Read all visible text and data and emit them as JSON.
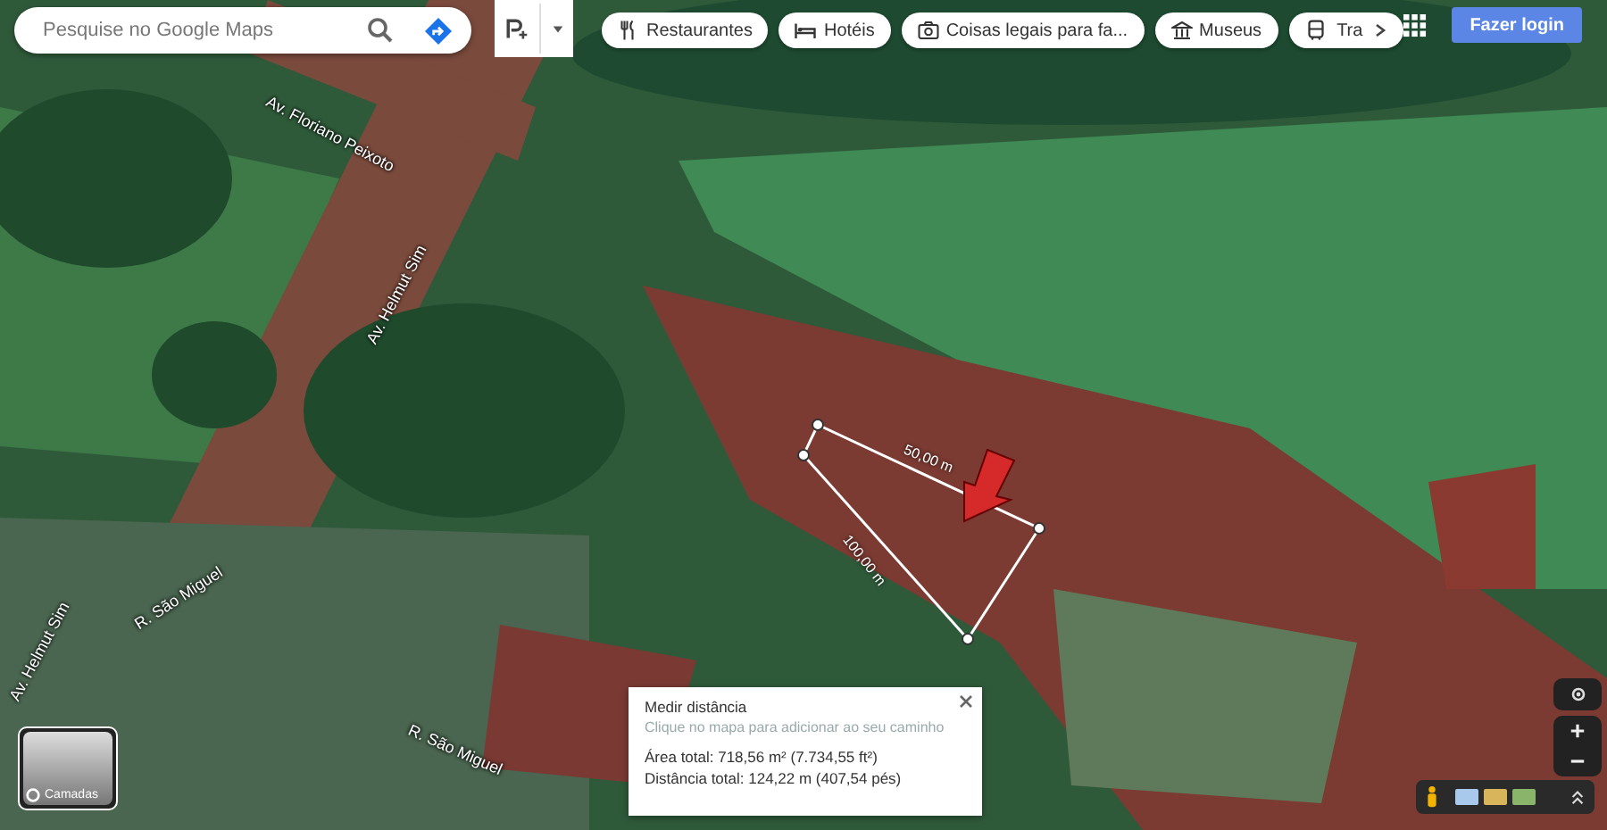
{
  "search": {
    "placeholder": "Pesquise no Google Maps"
  },
  "chips": [
    {
      "kind": "restaurant",
      "label": "Restaurantes"
    },
    {
      "kind": "hotel",
      "label": "Hotéis"
    },
    {
      "kind": "camera",
      "label": "Coisas legais para fa..."
    },
    {
      "kind": "museum",
      "label": "Museus"
    },
    {
      "kind": "transit",
      "label": "Tra"
    }
  ],
  "login_button": {
    "label": "Fazer login"
  },
  "map_labels": [
    "Av. Floriano Peixoto",
    "Av. Helmut Sim",
    "R. São Miguel",
    "R. São Miguel",
    "Av. Helmut Sim"
  ],
  "measurement": {
    "segment_labels": [
      "50,00 m",
      "100,00 m"
    ]
  },
  "measure_panel": {
    "title": "Medir distância",
    "hint": "Clique no mapa para adicionar ao seu caminho",
    "area": "Área total: 718,56 m² (7.734,55 ft²)",
    "distance": "Distância total: 124,22 m (407,54 pés)"
  },
  "layers_button": {
    "label": "Camadas"
  }
}
